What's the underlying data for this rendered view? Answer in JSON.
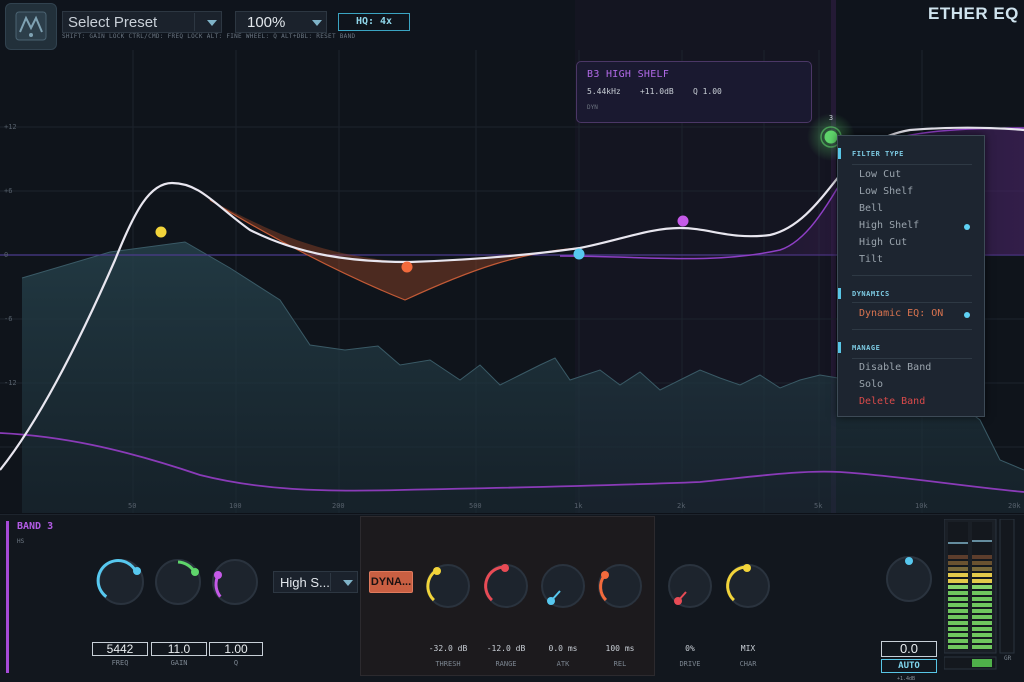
{
  "app": {
    "title": "ETHER EQ"
  },
  "header": {
    "preset_label": "Select Preset",
    "zoom_label": "100%",
    "hq_label": "HQ: 4x",
    "hints": "SHIFT: GAIN LOCK    CTRL/CMD: FREQ LOCK    ALT: FINE    WHEEL: Q    ALT+DBL: RESET BAND"
  },
  "graph": {
    "db_labels": [
      "+12",
      "+6",
      "0",
      "-6",
      "-12"
    ],
    "freq_labels": [
      "50",
      "100",
      "200",
      "500",
      "1k",
      "2k",
      "5k",
      "10k",
      "20k"
    ],
    "selected_band_number": "3"
  },
  "info_box": {
    "title": "B3 HIGH SHELF",
    "values": "5.44kHz    +11.0dB    Q 1.00",
    "mode": "DYN"
  },
  "context_menu": {
    "filter_type_title": "FILTER TYPE",
    "filter_types": [
      "Low Cut",
      "Low Shelf",
      "Bell",
      "High Shelf",
      "High Cut",
      "Tilt"
    ],
    "selected_filter": "High Shelf",
    "dynamics_title": "DYNAMICS",
    "dynamic_eq_label": "Dynamic EQ: ON",
    "manage_title": "MANAGE",
    "manage_items": [
      "Disable Band",
      "Solo",
      "Delete Band"
    ]
  },
  "band_panel": {
    "title": "BAND 3",
    "subtitle": "HS",
    "freq_value": "5442",
    "gain_value": "11.0",
    "q_value": "1.00",
    "freq_label": "FREQ",
    "gain_label": "GAIN",
    "q_label": "Q",
    "filter_type_value": "High S...",
    "dyn_button_label": "DYNA..."
  },
  "dynamics_panel": {
    "thresh_value": "-32.0 dB",
    "range_value": "-12.0 dB",
    "atk_value": "0.0 ms",
    "rel_value": "100 ms",
    "thresh_label": "THRESH",
    "range_label": "RANGE",
    "atk_label": "ATK",
    "rel_label": "REL"
  },
  "saturation": {
    "drive_value": "0%",
    "char_value": "MIX",
    "drive_label": "DRIVE",
    "char_label": "CHAR"
  },
  "output": {
    "gain_value": "0.0",
    "auto_label": "AUTO",
    "auto_sub": "+1.4dB",
    "gr_label": "GR"
  },
  "colors": {
    "band1": "#f2d43a",
    "band2": "#f26a3c",
    "band3": "#5fd56b",
    "band4": "#57c8ef",
    "band5": "#c55ae8",
    "accent": "#58c6e6"
  }
}
